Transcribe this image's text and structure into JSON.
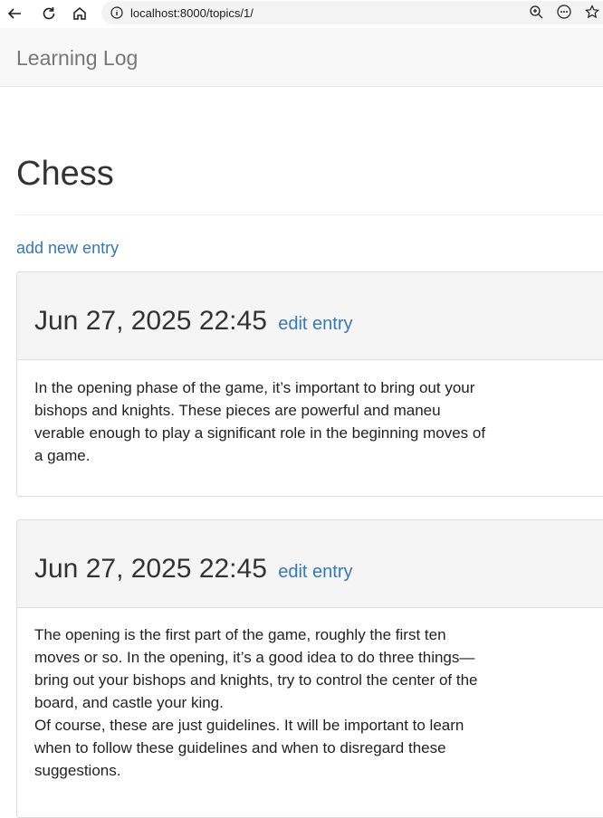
{
  "browser": {
    "url": "localhost:8000/topics/1/"
  },
  "navbar": {
    "brand": "Learning Log"
  },
  "topic": {
    "title": "Chess",
    "add_entry_label": "add new entry"
  },
  "entries": [
    {
      "date": "Jun 27, 2025 22:45",
      "edit_label": "edit entry",
      "paragraphs": [
        "In the opening phase of the game, it’s important to bring out your bishops and knights. These pieces are powerful and maneu verable enough to play a significant role in the beginning moves of a game."
      ]
    },
    {
      "date": "Jun 27, 2025 22:45",
      "edit_label": "edit entry",
      "paragraphs": [
        "The opening is the first part of the game, roughly the first ten moves or so. In the opening, it’s a good idea to do three things—bring out your bishops and knights, try to control the center of the board, and castle your king.",
        "Of course, these are just guidelines. It will be important to learn when to follow these guidelines and when to disregard these suggestions."
      ]
    }
  ]
}
